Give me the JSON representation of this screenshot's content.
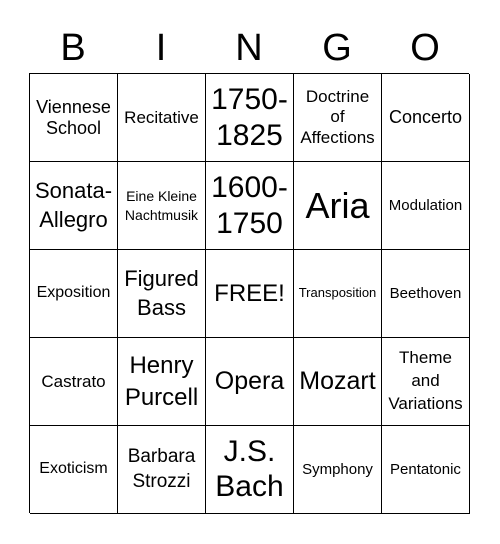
{
  "header": [
    "B",
    "I",
    "N",
    "G",
    "O"
  ],
  "cells": [
    "Viennese\nSchool",
    "Recitative",
    "1750-\n1825",
    "Doctrine\nof\nAffections",
    "Concerto",
    "Sonata-\nAllegro",
    "Eine Kleine\nNachtmusik",
    "1600-\n1750",
    "Aria",
    "Modulation",
    "Exposition",
    "Figured\nBass",
    "FREE!",
    "Transposition",
    "Beethoven",
    "Castrato",
    "Henry\nPurcell",
    "Opera",
    "Mozart",
    "Theme\nand\nVariations",
    "Exoticism",
    "Barbara\nStrozzi",
    "J.S.\nBach",
    "Symphony",
    "Pentatonic"
  ]
}
